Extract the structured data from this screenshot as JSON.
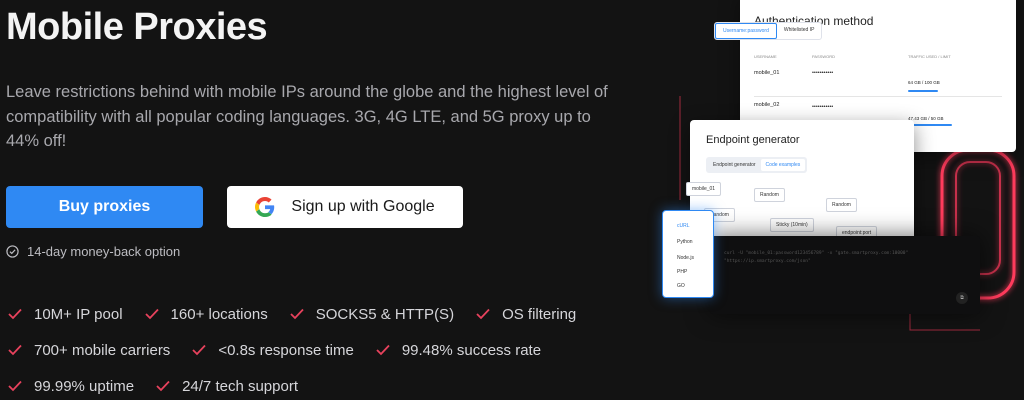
{
  "hero": {
    "title": "Mobile Proxies",
    "description": "Leave restrictions behind with mobile IPs around the globe and the highest level of compatibility with all popular coding languages. 3G, 4G LTE, and 5G proxy up to 44% off!",
    "buy_label": "Buy proxies",
    "google_label": "Sign up with Google",
    "guarantee": "14-day money-back option"
  },
  "features": [
    [
      "10M+ IP pool",
      "160+ locations",
      "SOCKS5 & HTTP(S)",
      "OS filtering"
    ],
    [
      "700+ mobile carriers",
      "<0.8s response time",
      "99.48% success rate"
    ],
    [
      "99.99% uptime",
      "24/7 tech support"
    ]
  ],
  "illustration": {
    "auth_title": "Authentication method",
    "auth_tabs": [
      "Username:password",
      "Whitelisted IP"
    ],
    "auth_headers": [
      "USERNAME",
      "PASSWORD",
      "TRAFFIC USED / LIMIT"
    ],
    "auth_rows": [
      {
        "user": "mobile_01",
        "pass": "•••••••••••",
        "usage": "64 GB / 100 GB",
        "fill": 0.64
      },
      {
        "user": "mobile_02",
        "pass": "•••••••••••",
        "usage": "47.43 GB / 50 GB",
        "fill": 0.95
      }
    ],
    "endpoint_title": "Endpoint generator",
    "endpoint_tabs": [
      "Endpoint generator",
      "Code examples"
    ],
    "fields": {
      "user": "mobile_01",
      "location": "Random",
      "isp": "Random",
      "session": "Random",
      "session_type": "Sticky (10min)",
      "protocol": "endpoint:port"
    },
    "languages": [
      "cURL",
      "Python",
      "Node.js",
      "PHP",
      "GO"
    ],
    "code": [
      "curl -U \"mobile_01:password123456789\" -x \"gate.smartproxy.com:10000\"",
      "\"https://ip.smartproxy.com/json\""
    ],
    "accent": "#2f89f3",
    "neon": "#ff3b5c"
  },
  "colors": {
    "background": "#131313",
    "primary": "#2f89f3",
    "check": "#e8425d"
  }
}
